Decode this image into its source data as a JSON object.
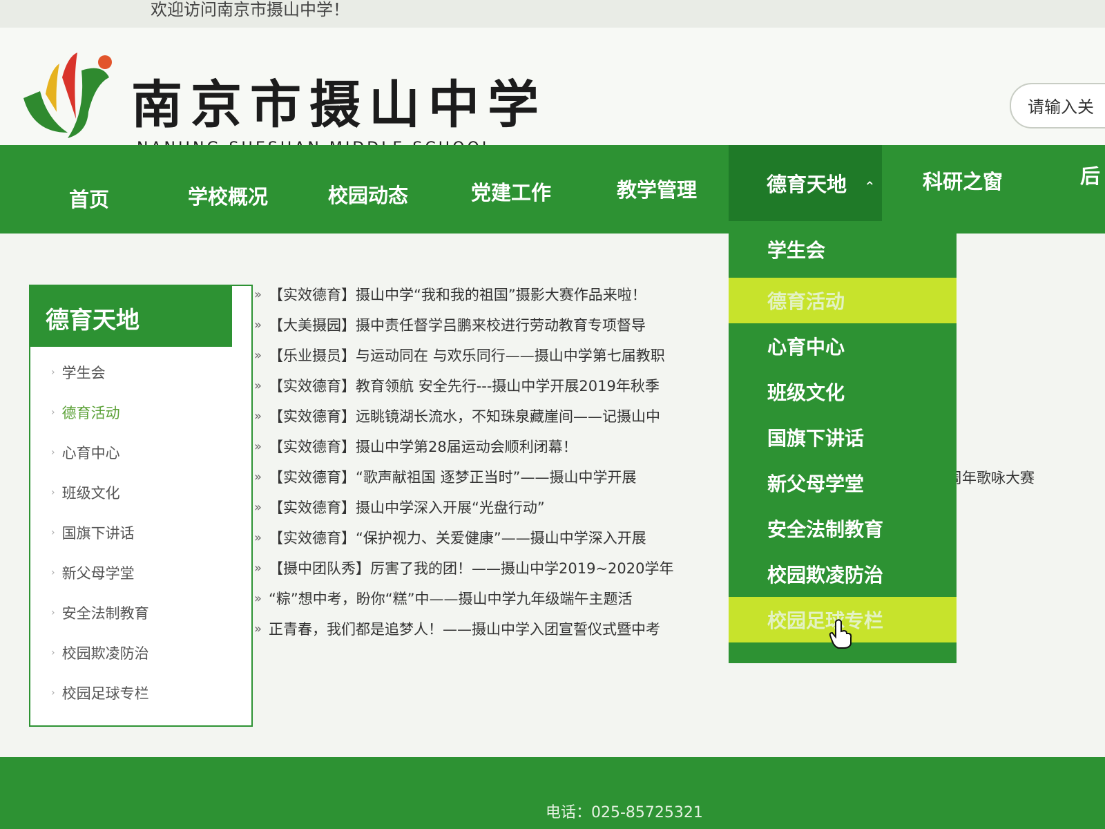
{
  "topbar": {
    "welcome": "欢迎访问南京市摄山中学！"
  },
  "header": {
    "title_cn": "南京市摄山中学",
    "title_en": "NANJING SHESHAN MIDDLE SCHOOL",
    "search_placeholder": "请输入关"
  },
  "nav": {
    "items": [
      "首页",
      "学校概况",
      "校园动态",
      "党建工作",
      "教学管理",
      "德育天地",
      "科研之窗",
      "后"
    ],
    "active": "德育天地",
    "caret_icon": "chevron-up-icon"
  },
  "sidebar": {
    "title": "德育天地",
    "items": [
      "学生会",
      "德育活动",
      "心育中心",
      "班级文化",
      "国旗下讲话",
      "新父母学堂",
      "安全法制教育",
      "校园欺凌防治",
      "校园足球专栏"
    ],
    "active": "德育活动"
  },
  "news": {
    "items": [
      "【实效德育】摄山中学“我和我的祖国”摄影大赛作品来啦！",
      "【大美摄园】摄中责任督学吕鹏来校进行劳动教育专项督导",
      "【乐业摄员】与运动同在 与欢乐同行——摄山中学第七届教职",
      "【实效德育】教育领航 安全先行---摄山中学开展2019年秋季",
      "【实效德育】远眺镜湖长流水，不知珠泉藏崖间——记摄山中",
      "【实效德育】摄山中学第28届运动会顺利闭幕！",
      "【实效德育】“歌声献祖国 逐梦正当时”——摄山中学开展",
      "【实效德育】摄山中学深入开展“光盘行动”",
      "【实效德育】“保护视力、关爱健康”——摄山中学深入开展",
      "【摄中团队秀】厉害了我的团！——摄山中学2019~2020学年",
      "“粽”想中考，盼你“糕”中——摄山中学九年级端午主题活",
      "正青春，我们都是追梦人！——摄山中学入团宣誓仪式暨中考"
    ],
    "overflow_tail": "周年歌咏大赛"
  },
  "dropdown": {
    "items": [
      "学生会",
      "德育活动",
      "心育中心",
      "班级文化",
      "国旗下讲话",
      "新父母学堂",
      "安全法制教育",
      "校园欺凌防治",
      "校园足球专栏"
    ],
    "highlighted": [
      "德育活动",
      "校园足球专栏"
    ]
  },
  "footer": {
    "phone": "电话：025-85725321"
  },
  "colors": {
    "brand_green": "#2d9233",
    "active_green": "#1f7a28",
    "highlight": "#c7e32c"
  }
}
